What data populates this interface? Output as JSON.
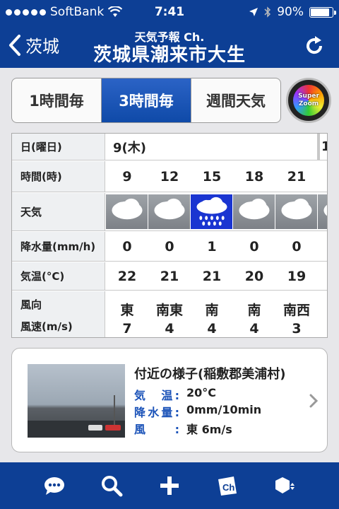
{
  "status": {
    "carrier": "SoftBank",
    "time": "7:41",
    "battery": "90%",
    "battery_level": 0.9
  },
  "nav": {
    "back_label": "茨城",
    "subtitle": "天気予報 Ch.",
    "title": "茨城県潮来市大生"
  },
  "tabs": [
    {
      "label": "1時間毎"
    },
    {
      "label": "3時間毎"
    },
    {
      "label": "週間天気"
    }
  ],
  "active_tab": 1,
  "super_zoom": {
    "line1": "Super",
    "line2": "Zoom"
  },
  "table": {
    "labels": {
      "date": "日(曜日)",
      "hour": "時間(時)",
      "weather": "天気",
      "precip": "降水量(mm/h)",
      "temp": "気温(°C)",
      "wind_dir": "風向",
      "wind_speed": "風速(m/s)"
    },
    "date": "9(木)",
    "date_next_partial": "1",
    "hours": [
      "9",
      "12",
      "15",
      "18",
      "21"
    ],
    "weather": [
      "cloudy",
      "cloudy",
      "rain",
      "cloudy",
      "cloudy",
      "cloudy"
    ],
    "precip": [
      "0",
      "0",
      "1",
      "0",
      "0"
    ],
    "temp": [
      "22",
      "21",
      "21",
      "20",
      "19"
    ],
    "wind_dir": [
      "東",
      "南東",
      "南",
      "南",
      "南西"
    ],
    "wind_speed": [
      "7",
      "4",
      "4",
      "4",
      "3"
    ]
  },
  "nearby": {
    "title": "付近の様子(稲敷郡美浦村)",
    "temp_label": "気　温:",
    "temp_value": "20°C",
    "precip_label": "降水量:",
    "precip_value": "0mm/10min",
    "wind_label": "風　:",
    "wind_value": "東 6m/s"
  },
  "toolbar": [
    "chat-icon",
    "search-icon",
    "add-icon",
    "channel-icon",
    "settings-icon"
  ],
  "colors": {
    "brand": "#0d3f95",
    "active_tab": "#1a52b8",
    "rain": "#1a35d1"
  }
}
